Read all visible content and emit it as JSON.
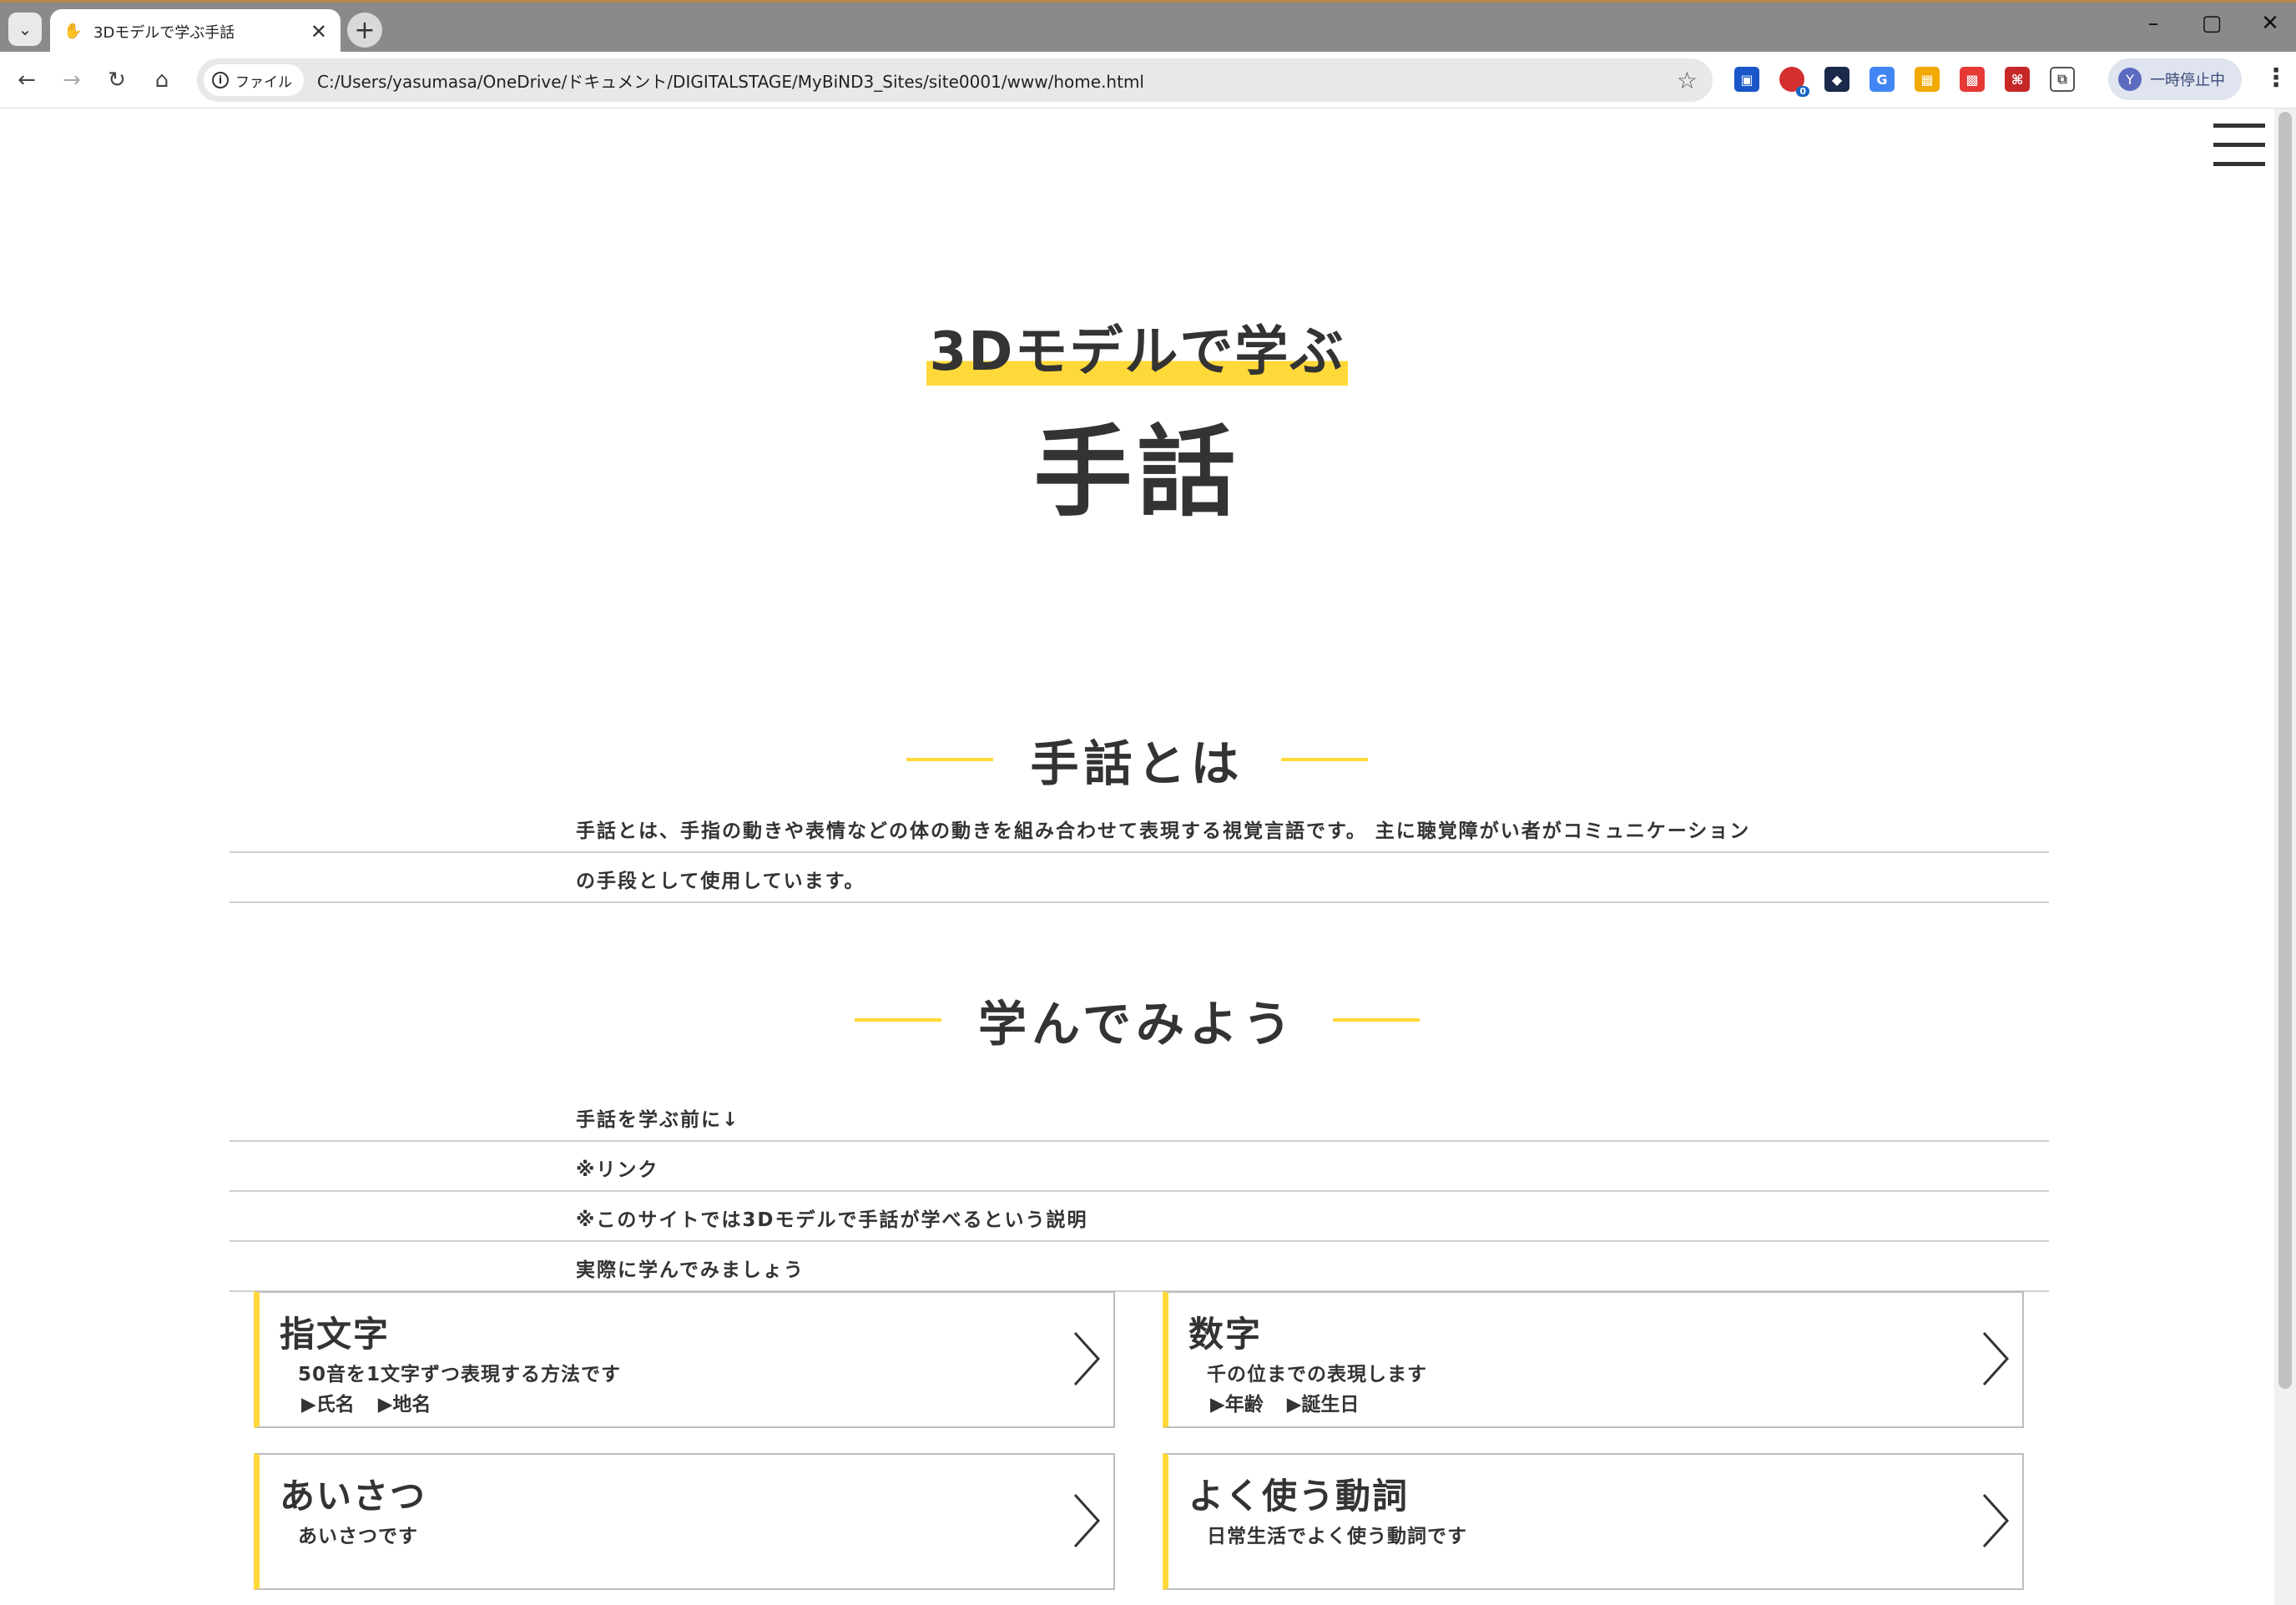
{
  "browser": {
    "tab_title": "3Dモデルで学ぶ手話",
    "new_tab_label": "+",
    "close_tab_label": "✕",
    "security_chip": "ファイル",
    "url": "C:/Users/yasumasa/OneDrive/ドキュメント/DIGITALSTAGE/MyBiND3_Sites/site0001/www/home.html",
    "profile_initial": "Y",
    "profile_label": "一時停止中",
    "extension_badge": "0"
  },
  "hero": {
    "subtitle": "3Dモデルで学ぶ",
    "title": "手話"
  },
  "about": {
    "heading": "手話とは",
    "lines": [
      "手話とは、手指の動きや表情などの体の動きを組み合わせて表現する視覚言語です。 主に聴覚障がい者がコミュニケーション",
      "の手段として使用しています。"
    ]
  },
  "learn": {
    "heading": "学んでみよう",
    "lines": [
      "手話を学ぶ前に↓",
      "※リンク",
      "※このサイトでは3Dモデルで手話が学べるという説明",
      "実際に学んでみましょう"
    ]
  },
  "cards": [
    {
      "title": "指文字",
      "desc": "50音を1文字ずつ表現する方法です",
      "links": [
        "▶氏名",
        "▶地名"
      ]
    },
    {
      "title": "数字",
      "desc": "千の位までの表現します",
      "links": [
        "▶年齢",
        "▶誕生日"
      ]
    },
    {
      "title": "あいさつ",
      "desc": "あいさつです",
      "links": []
    },
    {
      "title": "よく使う動詞",
      "desc": "日常生活でよく使う動詞です",
      "links": []
    }
  ],
  "colors": {
    "accent": "#ffd93a",
    "text": "#333333",
    "rule": "#cfcfcf"
  }
}
